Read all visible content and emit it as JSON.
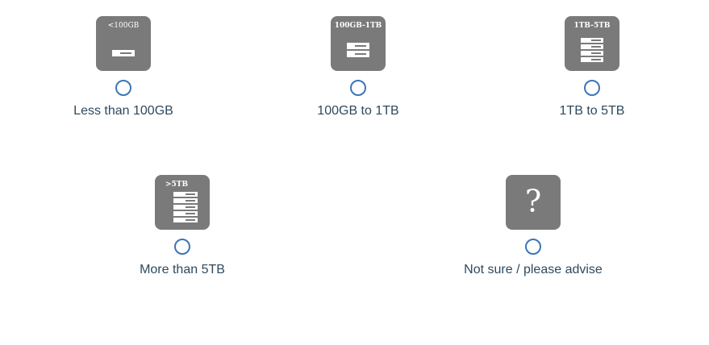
{
  "options": [
    {
      "tile_label": "<100GB",
      "label": "Less than 100GB",
      "icon": "single-drive-icon"
    },
    {
      "tile_label": "100GB-1TB",
      "label": "100GB to 1TB",
      "icon": "two-drives-icon"
    },
    {
      "tile_label": "1TB-5TB",
      "label": "1TB to 5TB",
      "icon": "three-drives-icon"
    },
    {
      "tile_label": ">5TB",
      "label": "More than 5TB",
      "icon": "four-drives-icon"
    },
    {
      "tile_label": "?",
      "label": "Not sure / please advise",
      "icon": "question-mark-icon"
    }
  ],
  "colors": {
    "tile": "#7a7a7a",
    "radio_border": "#3a76b6",
    "label_text": "#2e4a5e"
  }
}
